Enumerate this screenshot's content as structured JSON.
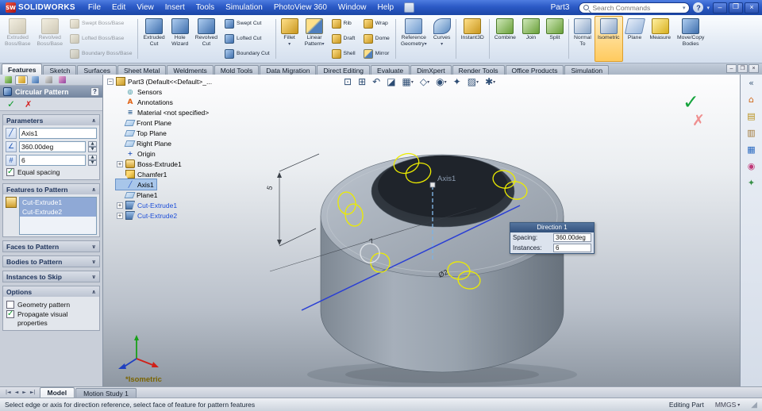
{
  "titlebar": {
    "logo_mark": "SW",
    "app_name": "SOLIDWORKS",
    "menus": [
      "File",
      "Edit",
      "View",
      "Insert",
      "Tools",
      "Simulation",
      "PhotoView 360",
      "Window",
      "Help"
    ],
    "document_title": "Part3",
    "search_placeholder": "Search Commands",
    "help_button": "?",
    "window_buttons": {
      "minimize": "–",
      "restore": "❐",
      "close": "×"
    }
  },
  "ribbon": {
    "columns": [
      {
        "items": [
          {
            "name": "extruded-boss-base-button",
            "l1": "Extruded",
            "l2": "Boss/Base",
            "ic": "ic-gold",
            "cls": "big disabled"
          }
        ]
      },
      {
        "items": [
          {
            "name": "revolved-boss-base-button",
            "l1": "Revolved",
            "l2": "Boss/Base",
            "ic": "ic-gold",
            "cls": "big disabled"
          }
        ]
      },
      {
        "items": [
          {
            "name": "swept-boss-base-button",
            "l1": "Swept Boss/Base",
            "ic": "ic-gold",
            "cls": "small disabled"
          },
          {
            "name": "lofted-boss-base-button",
            "l1": "Lofted Boss/Base",
            "ic": "ic-gold",
            "cls": "small disabled"
          },
          {
            "name": "boundary-boss-base-button",
            "l1": "Boundary Boss/Base",
            "ic": "ic-gold",
            "cls": "small disabled"
          }
        ]
      },
      {
        "cls": "col-sep",
        "items": []
      },
      {
        "items": [
          {
            "name": "extruded-cut-button",
            "l1": "Extruded",
            "l2": "Cut",
            "ic": "ic-blue",
            "cls": "big"
          }
        ]
      },
      {
        "items": [
          {
            "name": "hole-wizard-button",
            "l1": "Hole",
            "l2": "Wizard",
            "ic": "ic-blue",
            "cls": "big"
          }
        ]
      },
      {
        "items": [
          {
            "name": "revolved-cut-button",
            "l1": "Revolved",
            "l2": "Cut",
            "ic": "ic-blue",
            "cls": "big"
          }
        ]
      },
      {
        "items": [
          {
            "name": "swept-cut-button",
            "l1": "Swept Cut",
            "ic": "ic-blue",
            "cls": "small"
          },
          {
            "name": "lofted-cut-button",
            "l1": "Lofted Cut",
            "ic": "ic-blue",
            "cls": "small"
          },
          {
            "name": "boundary-cut-button",
            "l1": "Boundary Cut",
            "ic": "ic-blue",
            "cls": "small"
          }
        ]
      },
      {
        "cls": "col-sep",
        "items": []
      },
      {
        "items": [
          {
            "name": "fillet-button",
            "l1": "Fillet",
            "dd": "▾",
            "ic": "ic-gold",
            "cls": "big"
          }
        ]
      },
      {
        "items": [
          {
            "name": "linear-pattern-button",
            "l1": "Linear",
            "l2": "Pattern",
            "dd": "▾",
            "ic": "ic-mix",
            "cls": "big"
          }
        ]
      },
      {
        "items": [
          {
            "name": "rib-button",
            "l1": "Rib",
            "ic": "ic-gold",
            "cls": "small"
          },
          {
            "name": "draft-button",
            "l1": "Draft",
            "ic": "ic-gold",
            "cls": "small"
          },
          {
            "name": "shell-button",
            "l1": "Shell",
            "ic": "ic-gold",
            "cls": "small"
          }
        ]
      },
      {
        "items": [
          {
            "name": "wrap-button",
            "l1": "Wrap",
            "ic": "ic-gold",
            "cls": "small"
          },
          {
            "name": "dome-button",
            "l1": "Dome",
            "ic": "ic-gold",
            "cls": "small"
          },
          {
            "name": "mirror-button",
            "l1": "Mirror",
            "ic": "ic-mix",
            "cls": "small"
          }
        ]
      },
      {
        "cls": "col-sep",
        "items": []
      },
      {
        "items": [
          {
            "name": "reference-geometry-button",
            "l1": "Reference",
            "l2": "Geometry",
            "dd": "▾",
            "ic": "ic-ref",
            "cls": "big"
          }
        ]
      },
      {
        "items": [
          {
            "name": "curves-button",
            "l1": "Curves",
            "dd": "▾",
            "ic": "ic-curve",
            "cls": "big"
          }
        ]
      },
      {
        "cls": "col-sep",
        "items": []
      },
      {
        "items": [
          {
            "name": "instant3d-button",
            "l1": "Instant3D",
            "ic": "ic-gold",
            "cls": "big"
          }
        ]
      },
      {
        "cls": "col-sep",
        "items": []
      },
      {
        "items": [
          {
            "name": "combine-button",
            "l1": "Combine",
            "ic": "ic-green",
            "cls": "big"
          }
        ]
      },
      {
        "items": [
          {
            "name": "join-button",
            "l1": "Join",
            "ic": "ic-green",
            "cls": "big"
          }
        ]
      },
      {
        "items": [
          {
            "name": "split-button",
            "l1": "Split",
            "ic": "ic-green",
            "cls": "big"
          }
        ]
      },
      {
        "cls": "col-sep",
        "items": []
      },
      {
        "items": [
          {
            "name": "normal-to-button",
            "l1": "Normal",
            "l2": "To",
            "ic": "ic-view",
            "cls": "big"
          }
        ]
      },
      {
        "items": [
          {
            "name": "isometric-button",
            "l1": "Isometric",
            "ic": "ic-view",
            "cls": "big active"
          }
        ]
      },
      {
        "items": [
          {
            "name": "plane-button",
            "l1": "Plane",
            "ic": "ic-plane",
            "cls": "big"
          }
        ]
      },
      {
        "items": [
          {
            "name": "measure-button",
            "l1": "Measure",
            "ic": "ic-measure",
            "cls": "big"
          }
        ]
      },
      {
        "items": [
          {
            "name": "move-copy-bodies-button",
            "l1": "Move/Copy",
            "l2": "Bodies",
            "ic": "ic-blue",
            "cls": "big"
          }
        ]
      }
    ]
  },
  "tab_bar": {
    "tabs": [
      {
        "name": "tab-features",
        "label": "Features",
        "cls": "active"
      },
      {
        "name": "tab-sketch",
        "label": "Sketch"
      },
      {
        "name": "tab-surfaces",
        "label": "Surfaces"
      },
      {
        "name": "tab-sheet-metal",
        "label": "Sheet Metal"
      },
      {
        "name": "tab-weldments",
        "label": "Weldments"
      },
      {
        "name": "tab-mold-tools",
        "label": "Mold Tools"
      },
      {
        "name": "tab-data-migration",
        "label": "Data Migration"
      },
      {
        "name": "tab-direct-editing",
        "label": "Direct Editing"
      },
      {
        "name": "tab-evaluate",
        "label": "Evaluate"
      },
      {
        "name": "tab-dimxpert",
        "label": "DimXpert"
      },
      {
        "name": "tab-render-tools",
        "label": "Render Tools"
      },
      {
        "name": "tab-office-products",
        "label": "Office Products"
      },
      {
        "name": "tab-simulation",
        "label": "Simulation"
      }
    ],
    "doc_window_buttons": {
      "minimize": "–",
      "restore": "❐",
      "close": "×"
    }
  },
  "property_manager": {
    "manager_tabs": [
      {
        "name": "featuremanager-tab",
        "ic2": "pt-tree"
      },
      {
        "name": "propertymanager-tab",
        "ic2": "pt-prop",
        "cls": "active"
      },
      {
        "name": "configurationmanager-tab",
        "ic2": "pt-cfg"
      },
      {
        "name": "dimxpertmanager-tab",
        "ic2": "pt-dim"
      },
      {
        "name": "displaymanager-tab",
        "ic2": "pt-disp"
      }
    ],
    "title": "Circular Pattern",
    "help_button": "?",
    "ok_glyph": "✓",
    "cancel_glyph": "✗",
    "parameters": {
      "header": "Parameters",
      "collapse_glyph": "∧",
      "axis_value": "Axis1",
      "angle_value": "360.00deg",
      "count_value": "6",
      "equal_spacing_label": "Equal spacing"
    },
    "features_to_pattern": {
      "header": "Features to Pattern",
      "collapse_glyph": "∧",
      "items": [
        {
          "name": "pattern-feature-cut-extrude1",
          "label": "Cut-Extrude1",
          "cls": "sel"
        },
        {
          "name": "pattern-feature-cut-extrude2",
          "label": "Cut-Extrude2",
          "cls": "sel"
        }
      ]
    },
    "faces_to_pattern_header": "Faces to Pattern",
    "bodies_to_pattern_header": "Bodies to Pattern",
    "instances_to_skip_header": "Instances to Skip",
    "expand_glyph": "∨",
    "options": {
      "header": "Options",
      "collapse_glyph": "∧",
      "geometry_pattern_label": "Geometry pattern",
      "propagate_label": "Propagate visual properties"
    }
  },
  "feature_tree": {
    "items": [
      {
        "name": "tree-item-part3",
        "label": "Part3 (Default<<Default>_...",
        "ic": "ti-part",
        "exp": "−"
      },
      {
        "name": "tree-item-sensors",
        "label": "Sensors",
        "ic": "ti-sensors",
        "cls": "lvl1"
      },
      {
        "name": "tree-item-annotations",
        "label": "Annotations",
        "ic": "ti-annot",
        "cls": "lvl1"
      },
      {
        "name": "tree-item-material",
        "label": "Material <not specified>",
        "ic": "ti-material",
        "cls": "lvl1"
      },
      {
        "name": "tree-item-front-plane",
        "label": "Front Plane",
        "ic": "ti-plane",
        "cls": "lvl1"
      },
      {
        "name": "tree-item-top-plane",
        "label": "Top Plane",
        "ic": "ti-plane",
        "cls": "lvl1"
      },
      {
        "name": "tree-item-right-plane",
        "label": "Right Plane",
        "ic": "ti-plane",
        "cls": "lvl1"
      },
      {
        "name": "tree-item-origin",
        "label": "Origin",
        "ic": "ti-origin",
        "cls": "lvl1"
      },
      {
        "name": "tree-item-boss-extrude1",
        "label": "Boss-Extrude1",
        "ic": "ti-boss",
        "exp": "+",
        "cls": "lvl1"
      },
      {
        "name": "tree-item-chamfer1",
        "label": "Chamfer1",
        "ic": "ti-chamfer",
        "cls": "lvl1"
      },
      {
        "name": "tree-item-axis1",
        "label": "Axis1",
        "ic": "ti-axis",
        "cls": "lvl1 selected"
      },
      {
        "name": "tree-item-plane1",
        "label": "Plane1",
        "ic": "ti-plane",
        "cls": "lvl1"
      },
      {
        "name": "tree-item-cut-extrude1",
        "label": "Cut-Extrude1",
        "ic": "ti-cut",
        "exp": "+",
        "cls": "lvl1 hl"
      },
      {
        "name": "tree-item-cut-extrude2",
        "label": "Cut-Extrude2",
        "ic": "ti-cut",
        "exp": "+",
        "cls": "lvl1 hl"
      }
    ]
  },
  "hud": {
    "buttons": [
      {
        "name": "zoom-fit-icon",
        "glyph": "⊡"
      },
      {
        "name": "zoom-area-icon",
        "glyph": "⊞"
      },
      {
        "name": "previous-view-icon",
        "glyph": "↶"
      },
      {
        "name": "section-view-icon",
        "glyph": "◪"
      },
      {
        "name": "view-orientation-icon",
        "glyph": "▦",
        "dd": "▾"
      },
      {
        "name": "display-style-icon",
        "glyph": "◇",
        "dd": "▾"
      },
      {
        "name": "hide-show-items-icon",
        "glyph": "◉",
        "dd": "▾"
      },
      {
        "name": "edit-appearance-icon",
        "glyph": "✦"
      },
      {
        "name": "apply-scene-icon",
        "glyph": "▨",
        "dd": "▾"
      },
      {
        "name": "view-settings-icon",
        "glyph": "✱",
        "dd": "▾"
      }
    ]
  },
  "graphics": {
    "axis_label": "Axis1",
    "view_label": "*Isometric",
    "dim_height": "5",
    "dim_length": "7",
    "dim_diameter": "Ø2",
    "tooltip": {
      "title": "Direction 1",
      "spacing_label": "Spacing:",
      "spacing_value": "360.00deg",
      "instances_label": "Instances:",
      "instances_value": "6"
    },
    "confirm_ok_glyph": "✓",
    "confirm_cancel_glyph": "✗"
  },
  "task_pane": {
    "icons": [
      {
        "name": "collapse-pane-icon",
        "glyph": "«",
        "c": "c-slate"
      },
      {
        "name": "solidworks-resources-icon",
        "glyph": "⌂",
        "c": "c-orange"
      },
      {
        "name": "design-library-icon",
        "glyph": "▤",
        "c": "c-gold"
      },
      {
        "name": "file-explorer-icon",
        "glyph": "▥",
        "c": "c-tan"
      },
      {
        "name": "view-palette-icon",
        "glyph": "▦",
        "c": "c-blue"
      },
      {
        "name": "appearances-icon",
        "glyph": "◉",
        "c": "c-pink"
      },
      {
        "name": "custom-properties-icon",
        "glyph": "✦",
        "c": "c-green"
      }
    ]
  },
  "bottom_bar": {
    "nav": [
      {
        "name": "scroll-first-icon",
        "glyph": "|◄"
      },
      {
        "name": "scroll-prev-icon",
        "glyph": "◄"
      },
      {
        "name": "scroll-next-icon",
        "glyph": "►"
      },
      {
        "name": "scroll-last-icon",
        "glyph": "►|"
      }
    ],
    "tabs": [
      {
        "name": "model-tab",
        "label": "Model",
        "cls": "active"
      },
      {
        "name": "motion-study-tab",
        "label": "Motion Study 1"
      }
    ]
  },
  "status_bar": {
    "message": "Select edge or axis for direction reference, select face of feature for pattern features",
    "mode": "Editing Part",
    "units": "MMGS",
    "units_caret": "▾"
  },
  "colors": {
    "titlebar_blue": "#2b5ac6",
    "active_ribbon_highlight": "#ffca5e",
    "selection_blue": "#8fa9d6",
    "confirm_green": "#15a33c",
    "cancel_red": "#d42020",
    "pattern_preview_yellow": "#ecec00"
  }
}
